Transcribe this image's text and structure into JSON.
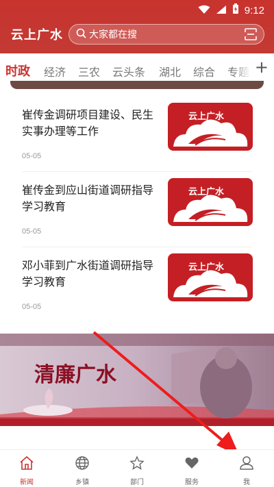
{
  "status_bar": {
    "time": "9:12"
  },
  "header": {
    "title": "云上广水",
    "search_placeholder": "大家都在搜"
  },
  "tabs": [
    {
      "label": "时政",
      "active": true
    },
    {
      "label": "经济"
    },
    {
      "label": "三农"
    },
    {
      "label": "云头条"
    },
    {
      "label": "湖北"
    },
    {
      "label": "综合"
    },
    {
      "label": "专题"
    }
  ],
  "news": [
    {
      "title": "崔传金调研项目建设、民生实事办理等工作",
      "date": "05-05",
      "thumb_text": "云上广水"
    },
    {
      "title": "崔传金到应山街道调研指导学习教育",
      "date": "05-05",
      "thumb_text": "云上广水"
    },
    {
      "title": "邓小菲到广水街道调研指导学习教育",
      "date": "05-05",
      "thumb_text": "云上广水"
    }
  ],
  "banner": {
    "text": "清廉广水"
  },
  "bottom_nav": [
    {
      "label": "新闻",
      "icon": "home-icon",
      "active": true
    },
    {
      "label": "乡镇",
      "icon": "globe-icon"
    },
    {
      "label": "部门",
      "icon": "star-icon"
    },
    {
      "label": "服务",
      "icon": "heart-icon"
    },
    {
      "label": "我",
      "icon": "user-icon"
    }
  ],
  "colors": {
    "brand_red": "#c8332e",
    "text": "#222222",
    "muted": "#999999"
  }
}
